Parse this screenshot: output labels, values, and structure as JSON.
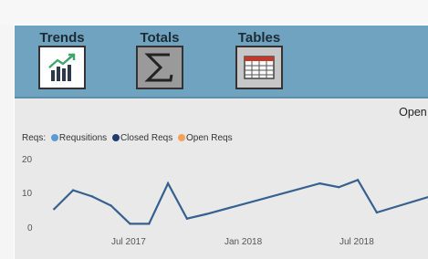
{
  "nav": {
    "tabs": [
      {
        "label": "Trends",
        "icon": "trend-chart-icon"
      },
      {
        "label": "Totals",
        "icon": "sigma-icon"
      },
      {
        "label": "Tables",
        "icon": "table-icon"
      }
    ]
  },
  "chart_data": {
    "type": "line",
    "title": "Open vs Cl",
    "legend_title": "Reqs:",
    "legend": [
      {
        "name": "Requsitions",
        "color": "#5b9bd5"
      },
      {
        "name": "Closed Reqs",
        "color": "#1f3b6e"
      },
      {
        "name": "Open Reqs",
        "color": "#f4a259"
      }
    ],
    "y_ticks": [
      "20",
      "10",
      "0"
    ],
    "ylim": [
      0,
      20
    ],
    "x_ticks": [
      "Jul 2017",
      "Jan 2018",
      "Jul 2018"
    ],
    "series": [
      {
        "name": "Closed Reqs",
        "color": "#35608f",
        "x": [
          "2017-02",
          "2017-03",
          "2017-04",
          "2017-05",
          "2017-06",
          "2017-07",
          "2017-08",
          "2017-09",
          "2017-10",
          "2018-04",
          "2018-05",
          "2018-06",
          "2018-07",
          "2018-10"
        ],
        "values": [
          5,
          10.5,
          8.7,
          6,
          0.7,
          0.7,
          12.5,
          2.2,
          3.5,
          12.5,
          11.4,
          13.5,
          4,
          9
        ]
      }
    ]
  }
}
